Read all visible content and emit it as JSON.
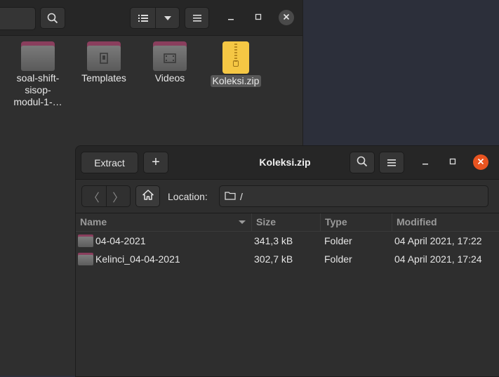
{
  "file_manager": {
    "items": [
      {
        "label": "soal-shift-\nsisop-\nmodul-1-…",
        "icon": "folder-icon"
      },
      {
        "label": "Templates",
        "icon": "folder-templates-icon"
      },
      {
        "label": "Videos",
        "icon": "folder-videos-icon"
      },
      {
        "label": "Koleksi.zip",
        "icon": "zip-archive-icon"
      }
    ]
  },
  "archive": {
    "extract_label": "Extract",
    "add_label": "+",
    "title": "Koleksi.zip",
    "location_label": "Location:",
    "location_value": "/",
    "columns": {
      "name": "Name",
      "size": "Size",
      "type": "Type",
      "modified": "Modified"
    },
    "rows": [
      {
        "name": "04-04-2021",
        "size": "341,3 kB",
        "type": "Folder",
        "modified": "04 April 2021, 17:22"
      },
      {
        "name": "Kelinci_04-04-2021",
        "size": "302,7 kB",
        "type": "Folder",
        "modified": "04 April 2021, 17:24"
      }
    ]
  },
  "colors": {
    "close_active": "#e95420",
    "folder_tab": "#8a3e5d",
    "zip": "#f5c744"
  }
}
